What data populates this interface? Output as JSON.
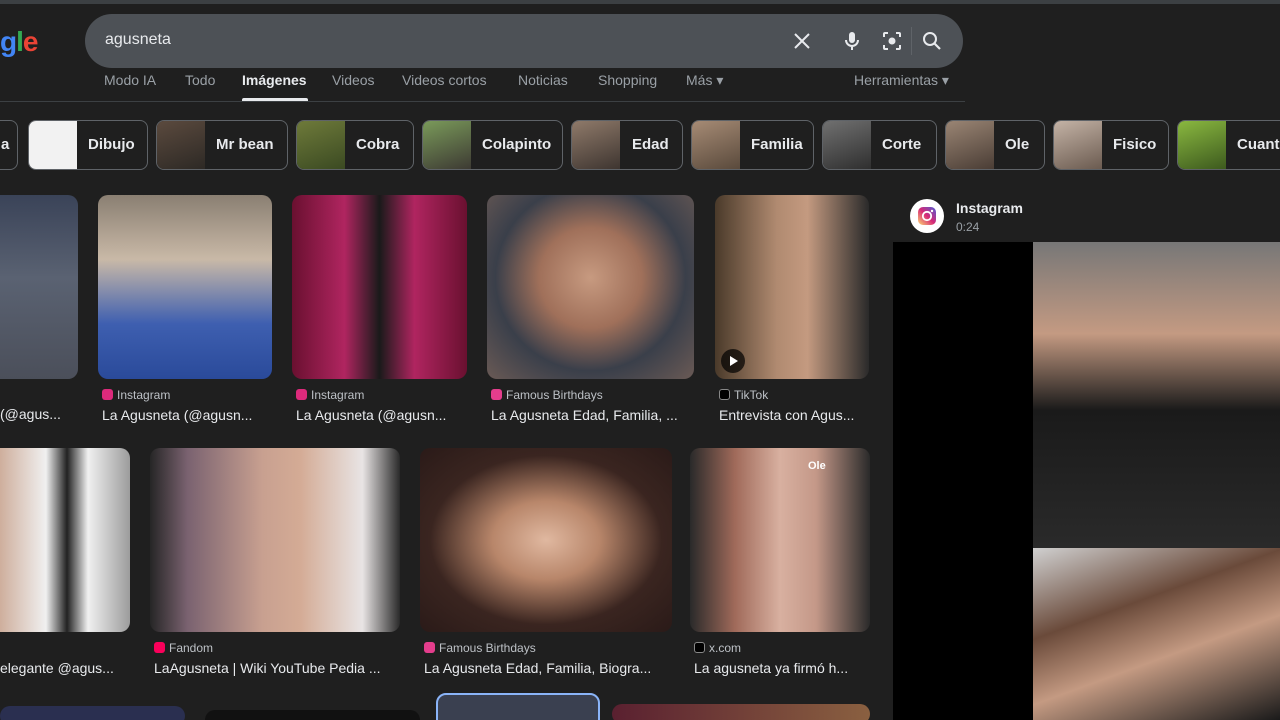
{
  "logo": {
    "part1": "g",
    "part2": "l",
    "part3": "e"
  },
  "search": {
    "query": "agusneta",
    "icons": [
      "close-icon",
      "mic-icon",
      "lens-icon",
      "search-icon"
    ]
  },
  "tabs": [
    {
      "label": "Modo IA"
    },
    {
      "label": "Todo"
    },
    {
      "label": "Imágenes"
    },
    {
      "label": "Videos"
    },
    {
      "label": "Videos cortos"
    },
    {
      "label": "Noticias"
    },
    {
      "label": "Shopping"
    },
    {
      "label": "Más ▾"
    },
    {
      "label": "Herramientas ▾"
    }
  ],
  "chips": [
    {
      "label": "a"
    },
    {
      "label": "Dibujo"
    },
    {
      "label": "Mr bean"
    },
    {
      "label": "Cobra"
    },
    {
      "label": "Colapinto"
    },
    {
      "label": "Edad"
    },
    {
      "label": "Familia"
    },
    {
      "label": "Corte"
    },
    {
      "label": "Ole"
    },
    {
      "label": "Fisico"
    },
    {
      "label": "Cuanto"
    }
  ],
  "results": [
    {
      "source": "",
      "title": "(@agus..."
    },
    {
      "source": "Instagram",
      "title": "La Agusneta (@agusn..."
    },
    {
      "source": "Instagram",
      "title": "La Agusneta (@agusn..."
    },
    {
      "source": "Famous Birthdays",
      "title": "La Agusneta Edad, Familia, ..."
    },
    {
      "source": "TikTok",
      "title": "Entrevista con Agus..."
    },
    {
      "source": "",
      "title": "elegante @agus..."
    },
    {
      "source": "Fandom",
      "title": "LaAgusneta | Wiki YouTube Pedia ..."
    },
    {
      "source": "Famous Birthdays",
      "title": "La Agusneta Edad, Familia, Biogra..."
    },
    {
      "source": "x.com",
      "title": "La agusneta ya firmó h..."
    }
  ],
  "overlay": {
    "ole_label": "Ole"
  },
  "panel": {
    "name": "Instagram",
    "duration": "0:24"
  },
  "colors": {
    "background": "#1f1f1f",
    "searchbar": "#4d5156",
    "accent": "#e8eaed"
  }
}
